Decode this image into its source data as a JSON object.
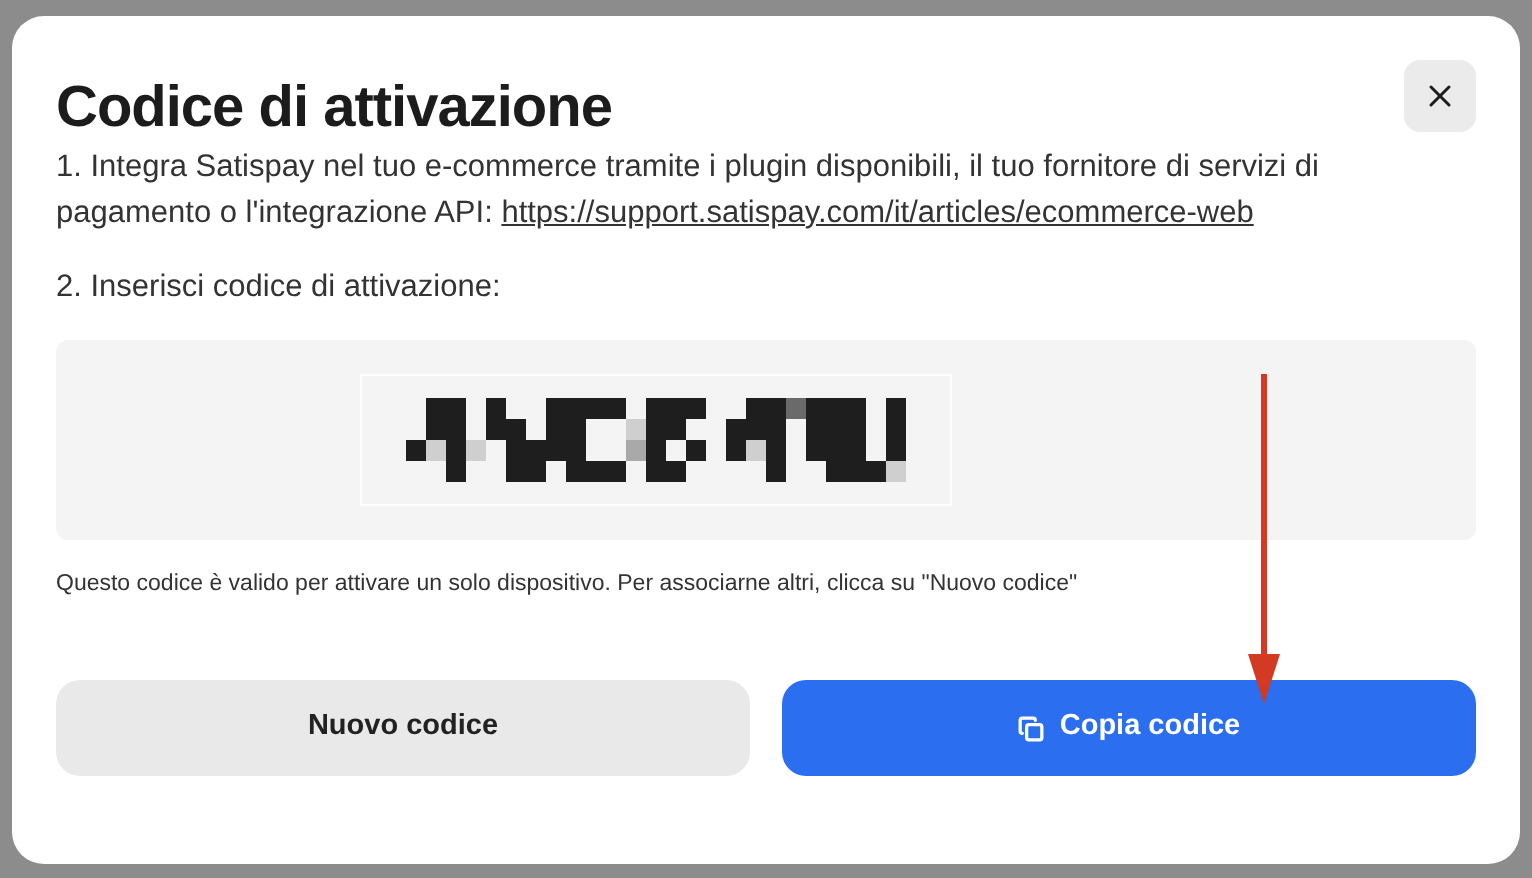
{
  "dialog": {
    "title": "Codice di attivazione",
    "steps": [
      {
        "text": "1. Integra Satispay nel tuo e-commerce tramite i plugin disponibili, il tuo fornitore di servizi di pagamento o l'integrazione API:",
        "link": "https://support.satispay.com/it/articles/ecommerce-web"
      },
      {
        "text": "2. Inserisci codice di attivazione:"
      }
    ],
    "note": "Questo codice è valido per attivare un solo dispositivo. Per associarne altri, clicca su \"Nuovo codice\"",
    "buttons": [
      {
        "label": "Nuovo codice",
        "kind": "secondary"
      },
      {
        "label": "Copia codice",
        "kind": "primary"
      }
    ]
  }
}
